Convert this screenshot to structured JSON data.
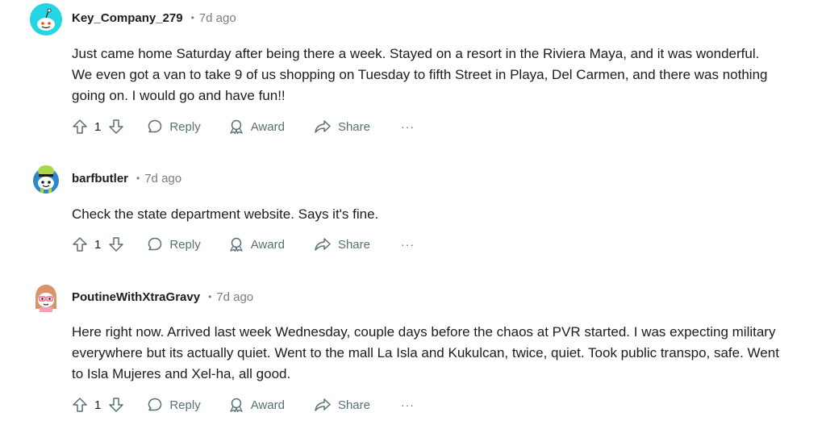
{
  "comments": [
    {
      "username": "Key_Company_279",
      "time": "7d ago",
      "text": "Just came home Saturday after being there a week. Stayed on a resort in the Riviera Maya, and it was wonderful. We even got a van to take 9 of us shopping on Tuesday to fifth Street in Playa, Del Carmen, and there was nothing going on. I would go and have fun!!",
      "votes": "1",
      "avatar_color": "#24d6e3"
    },
    {
      "username": "barfbutler",
      "time": "7d ago",
      "text": "Check the state department website. Says it's fine.",
      "votes": "1",
      "avatar_color": "#a8d84a"
    },
    {
      "username": "PoutineWithXtraGravy",
      "time": "7d ago",
      "text": "Here right now. Arrived last week Wednesday, couple days before the chaos at PVR started. I was expecting military everywhere but its actually quiet. Went to the mall La Isla and Kukulcan, twice, quiet. Took public transpo, safe. Went to Isla Mujeres and Xel-ha, all good.",
      "votes": "1",
      "avatar_color": "#f2a3b3"
    }
  ],
  "actions": {
    "separator": "•",
    "reply": "Reply",
    "award": "Award",
    "share": "Share",
    "more": "···"
  }
}
